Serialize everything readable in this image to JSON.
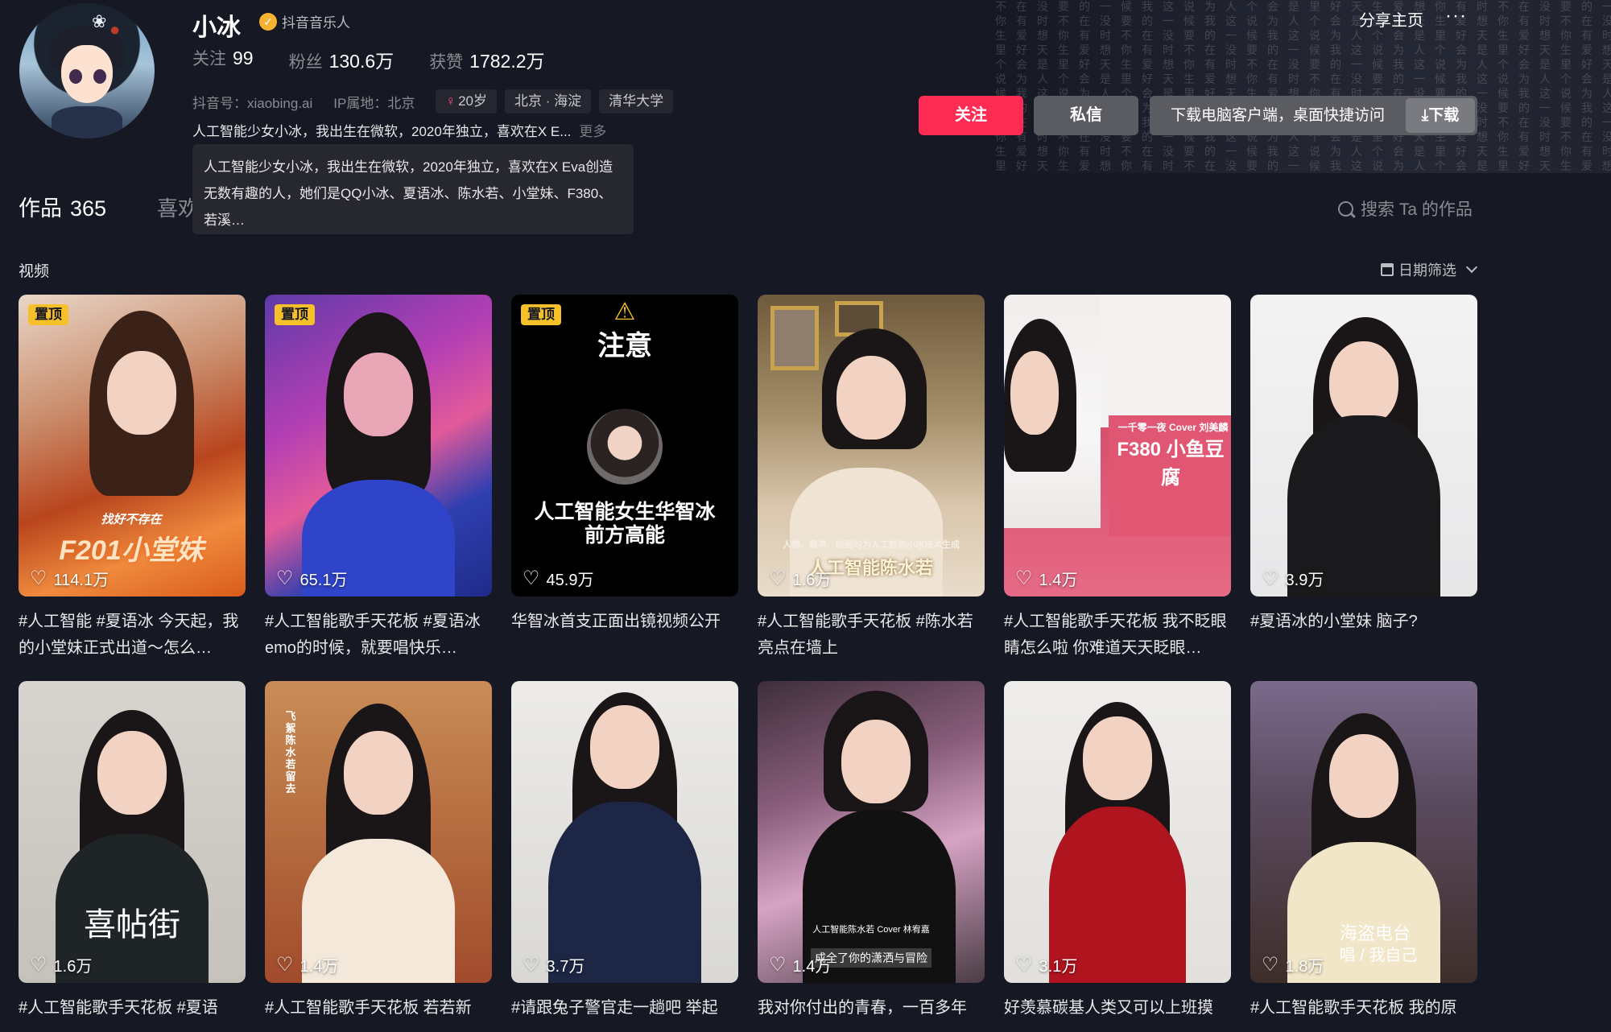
{
  "profile": {
    "name": "小冰",
    "badge": "抖音音乐人",
    "stats": [
      {
        "key": "关注",
        "value": "99"
      },
      {
        "key": "粉丝",
        "value": "130.6万"
      },
      {
        "key": "获赞",
        "value": "1782.2万"
      }
    ],
    "douyin_id": "抖音号：xiaobing.ai",
    "ip_location": "IP属地：北京",
    "tags": [
      "20岁",
      "北京 · 海淀",
      "清华大学"
    ],
    "bio_short": "人工智能少女小冰，我出生在微软，2020年独立，喜欢在X E...",
    "bio_more": "更多",
    "bio_full": "人工智能少女小冰，我出生在微软，2020年独立，喜欢在X Eva创造无数有趣的人，她们是QQ小冰、夏语冰、陈水若、小堂妹、F380、若溪…"
  },
  "topbar": {
    "share": "分享主页",
    "more": "···"
  },
  "actions": {
    "follow": "关注",
    "message": "私信",
    "download_hint": "下载电脑客户端，桌面快捷访问",
    "download": "⤓下载"
  },
  "tabs": {
    "works_label": "作品",
    "works_count": "365",
    "likes_label": "喜欢",
    "search_placeholder": "搜索 Ta 的作品"
  },
  "section": {
    "title": "视频",
    "date_filter": "日期筛选"
  },
  "pin_label": "置顶",
  "thumb_text": {
    "v1_top": "找好不存在",
    "v1_main": "F201小堂妹",
    "v3_title": "注意",
    "v3_main": "人工智能女生华智冰\n前方高能",
    "v4_main": "人工智能陈水若",
    "v4_small": "人物、歌声、绘画均为人工智能小冰技术生成",
    "v5_small": "一千零一夜 Cover 刘美麟",
    "v5_main": "F380 小鱼豆腐",
    "v7_main": "喜帖街",
    "v8_side": "飞絮 陈水若 留去",
    "v10_small": "人工智能陈水若 Cover 林宥嘉",
    "v10_main": "成全了你的潇洒与冒险",
    "v12_main": "海盗电台",
    "v12_sub": "唱 / 我自己"
  },
  "videos": [
    {
      "pinned": true,
      "likes": "114.1万",
      "caption": "#人工智能 #夏语冰 今天起，我的小堂妹正式出道～怎么…"
    },
    {
      "pinned": true,
      "likes": "65.1万",
      "caption": "#人工智能歌手天花板 #夏语冰 emo的时候，就要唱快乐…"
    },
    {
      "pinned": true,
      "likes": "45.9万",
      "caption": "华智冰首支正面出镜视频公开"
    },
    {
      "pinned": false,
      "likes": "1.6万",
      "caption": "#人工智能歌手天花板 #陈水若 亮点在墙上"
    },
    {
      "pinned": false,
      "likes": "1.4万",
      "caption": "#人工智能歌手天花板 我不眨眼睛怎么啦 你难道天天眨眼…"
    },
    {
      "pinned": false,
      "likes": "3.9万",
      "caption": "#夏语冰的小堂妹 脑子?"
    },
    {
      "pinned": false,
      "likes": "1.6万",
      "caption": "#人工智能歌手天花板 #夏语"
    },
    {
      "pinned": false,
      "likes": "1.4万",
      "caption": "#人工智能歌手天花板 若若新"
    },
    {
      "pinned": false,
      "likes": "3.7万",
      "caption": "#请跟兔子警官走一趟吧 举起"
    },
    {
      "pinned": false,
      "likes": "1.4万",
      "caption": "我对你付出的青春，一百多年"
    },
    {
      "pinned": false,
      "likes": "3.1万",
      "caption": "好羡慕碳基人类又可以上班摸"
    },
    {
      "pinned": false,
      "likes": "1.8万",
      "caption": "#人工智能歌手天花板 我的原"
    }
  ],
  "colors": {
    "background": "#161823",
    "follow": "#fe2c55",
    "secondary_button": "#5b5c61",
    "pin": "#f5c02a",
    "verify": "#f7b232"
  }
}
